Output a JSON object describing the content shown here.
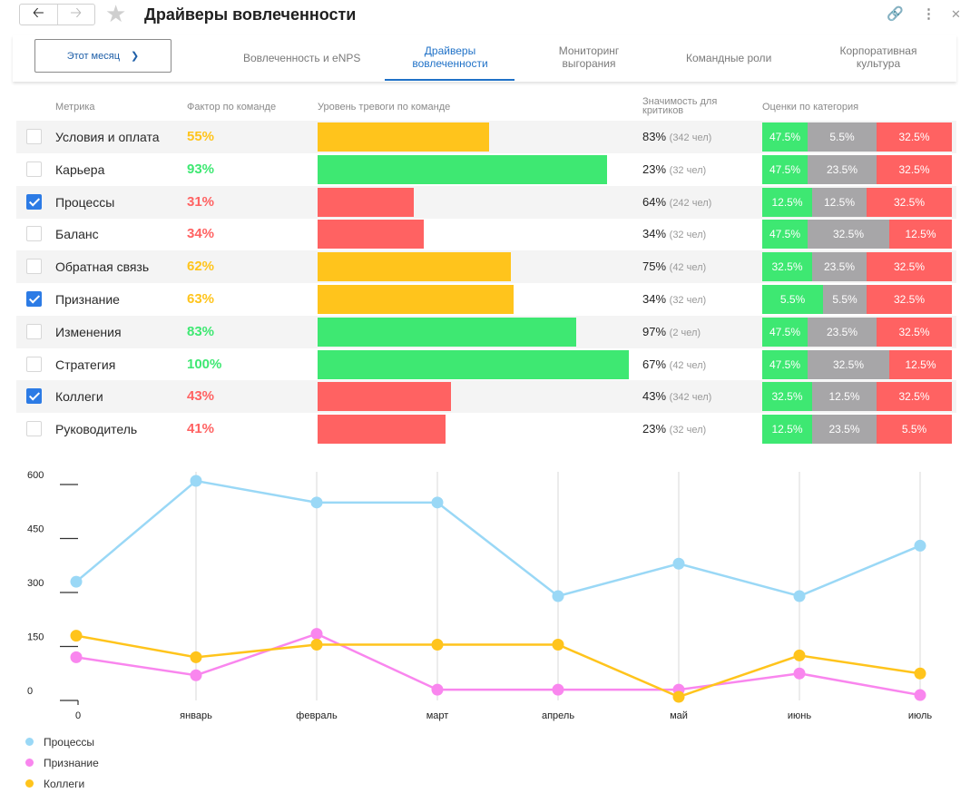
{
  "title": "Драйверы вовлеченности",
  "period_label": "Этот месяц",
  "tabs": [
    {
      "label": "Вовлеченность и eNPS"
    },
    {
      "label": "Драйверы вовлеченности"
    },
    {
      "label": "Мониторинг выгорания"
    },
    {
      "label": "Командные роли"
    },
    {
      "label": "Корпоративная культура"
    }
  ],
  "active_tab": 1,
  "table": {
    "headers": [
      "Метрика",
      "Фактор по команде",
      "Уровень тревоги по команде",
      "Значимость для критиков",
      "Оценки по категория"
    ],
    "colors": {
      "good": "#3ee872",
      "warn": "#ffc41c",
      "bad": "#ff6262",
      "neutral": "#a7a6a8"
    },
    "rows": [
      {
        "name": "Условия и оплата",
        "checked": false,
        "factor": "55%",
        "level": "warn",
        "alarm": 0.55,
        "sig": "83%",
        "sig_count": "(342 чел)",
        "scores": [
          "47.5%",
          "5.5%",
          "32.5%"
        ]
      },
      {
        "name": "Карьера",
        "checked": false,
        "factor": "93%",
        "level": "good",
        "alarm": 0.93,
        "sig": "23%",
        "sig_count": "(32 чел)",
        "scores": [
          "47.5%",
          "23.5%",
          "32.5%"
        ]
      },
      {
        "name": "Процессы",
        "checked": true,
        "factor": "31%",
        "level": "bad",
        "alarm": 0.31,
        "sig": "64%",
        "sig_count": "(242 чел)",
        "scores": [
          "12.5%",
          "12.5%",
          "32.5%"
        ]
      },
      {
        "name": "Баланс",
        "checked": false,
        "factor": "34%",
        "level": "bad",
        "alarm": 0.34,
        "sig": "34%",
        "sig_count": "(32 чел)",
        "scores": [
          "47.5%",
          "32.5%",
          "12.5%"
        ]
      },
      {
        "name": "Обратная связь",
        "checked": false,
        "factor": "62%",
        "level": "warn",
        "alarm": 0.62,
        "sig": "75%",
        "sig_count": "(42 чел)",
        "scores": [
          "32.5%",
          "23.5%",
          "32.5%"
        ]
      },
      {
        "name": "Признание",
        "checked": true,
        "factor": "63%",
        "level": "warn",
        "alarm": 0.63,
        "sig": "34%",
        "sig_count": "(32 чел)",
        "scores": [
          "5.5%",
          "5.5%",
          "32.5%"
        ]
      },
      {
        "name": "Изменения",
        "checked": false,
        "factor": "83%",
        "level": "good",
        "alarm": 0.83,
        "sig": "97%",
        "sig_count": "(2 чел)",
        "scores": [
          "47.5%",
          "23.5%",
          "32.5%"
        ]
      },
      {
        "name": "Стратегия",
        "checked": false,
        "factor": "100%",
        "level": "good",
        "alarm": 1.0,
        "sig": "67%",
        "sig_count": "(42 чел)",
        "scores": [
          "47.5%",
          "32.5%",
          "12.5%"
        ]
      },
      {
        "name": "Коллеги",
        "checked": true,
        "factor": "43%",
        "level": "bad",
        "alarm": 0.43,
        "sig": "43%",
        "sig_count": "(342 чел)",
        "scores": [
          "32.5%",
          "12.5%",
          "32.5%"
        ]
      },
      {
        "name": "Руководитель",
        "checked": false,
        "factor": "41%",
        "level": "bad",
        "alarm": 0.41,
        "sig": "23%",
        "sig_count": "(32 чел)",
        "scores": [
          "12.5%",
          "23.5%",
          "5.5%"
        ]
      }
    ]
  },
  "chart_data": {
    "type": "line",
    "x": [
      "0",
      "январь",
      "февраль",
      "март",
      "апрель",
      "май",
      "июнь",
      "июль"
    ],
    "y_ticks": [
      0,
      150,
      300,
      450,
      600
    ],
    "ylim": [
      0,
      600
    ],
    "grid": "vertical",
    "legend_position": "bottom-left",
    "series": [
      {
        "name": "Процессы",
        "color": "#9ad8f6",
        "values": [
          330,
          610,
          550,
          550,
          290,
          380,
          290,
          430
        ]
      },
      {
        "name": "Признание",
        "color": "#f986ee",
        "values": [
          120,
          70,
          185,
          30,
          30,
          30,
          75,
          15
        ]
      },
      {
        "name": "Коллеги",
        "color": "#ffc41c",
        "values": [
          180,
          120,
          155,
          155,
          155,
          10,
          125,
          75
        ]
      }
    ]
  }
}
